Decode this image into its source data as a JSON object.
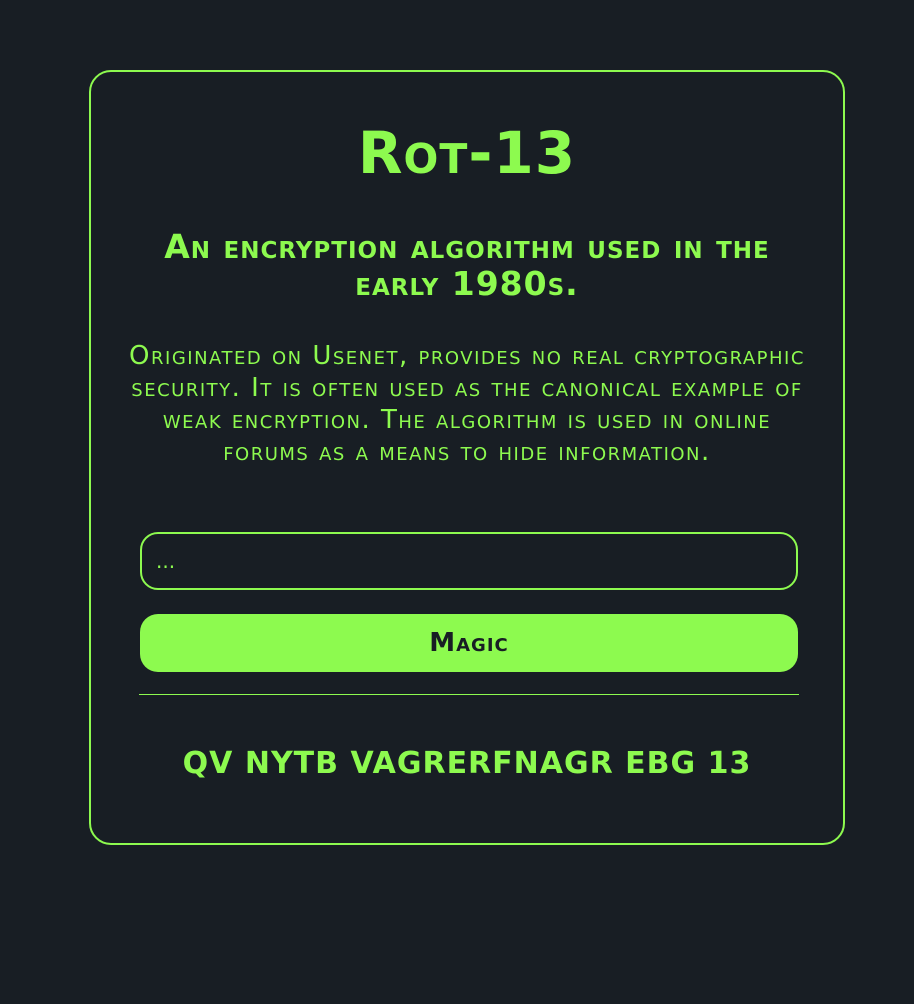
{
  "app": {
    "title": "Rot-13",
    "subtitle": "An encryption algorithm used in the early 1980s.",
    "description": "Originated on Usenet, provides no real cryptographic security. It is often used as the canonical example of weak encryption. The algorithm is used in online forums as a means to hide information."
  },
  "form": {
    "input_placeholder": "...",
    "input_value": "",
    "button_label": "Magic"
  },
  "result": {
    "text": "QV NYTB VAGRERFNAGR EBG 13"
  },
  "colors": {
    "background": "#181e24",
    "accent": "#8dfa4f",
    "button_text": "#181e24"
  }
}
